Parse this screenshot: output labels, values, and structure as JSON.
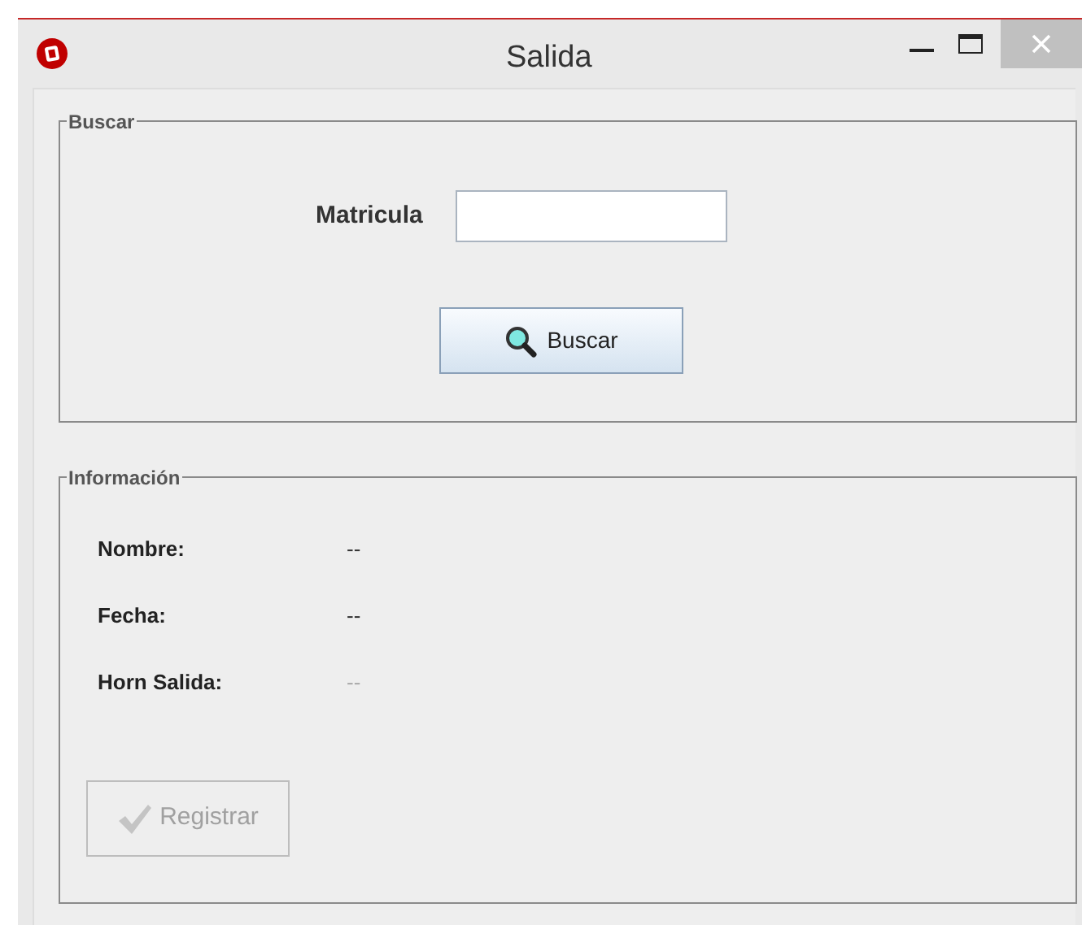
{
  "window": {
    "title": "Salida"
  },
  "search_group": {
    "title": "Buscar",
    "field_label": "Matricula",
    "button": "Buscar"
  },
  "info_group": {
    "title": "Información",
    "rows": [
      {
        "label": "Nombre:",
        "value": "--",
        "dimmed": false
      },
      {
        "label": "Fecha:",
        "value": "--",
        "dimmed": false
      },
      {
        "label": "Horn Salida:",
        "value": "--",
        "dimmed": true
      }
    ],
    "button": {
      "label": "Registrar",
      "disabled": true
    }
  }
}
